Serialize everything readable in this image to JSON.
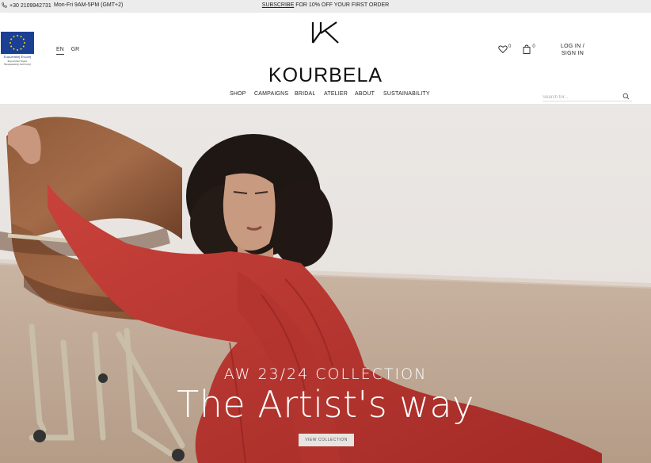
{
  "topbar": {
    "phone": "+30 2109942731",
    "hours": "Mon-Fri 9AM-5PM (GMT+2)",
    "promo_link": "SUBSCRIBE",
    "promo_text": " FOR 10% OFF YOUR  FIRST ORDER"
  },
  "eu": {
    "caption": "Ευρωπαϊκή Ένωση",
    "subcaption": "Ευρωπαϊκό Ταμείο Περιφερειακής Ανάπτυξης"
  },
  "lang": {
    "en": "EN",
    "gr": "GR"
  },
  "logo": {
    "wordmark": "KOURBELA"
  },
  "icons": {
    "wishlist_count": "0",
    "cart_count": "0"
  },
  "login": {
    "label": "LOG IN / SIGN IN"
  },
  "nav": {
    "items": [
      "SHOP",
      "CAMPAIGNS",
      "BRIDAL",
      "ATELIER",
      "ABOUT",
      "SUSTAINABILITY"
    ]
  },
  "search": {
    "placeholder": "Search for..."
  },
  "hero": {
    "eyebrow": "AW 23/24 COLLECTION",
    "headline": "The Artist's way",
    "cta": "VIEW COLLECTION"
  }
}
